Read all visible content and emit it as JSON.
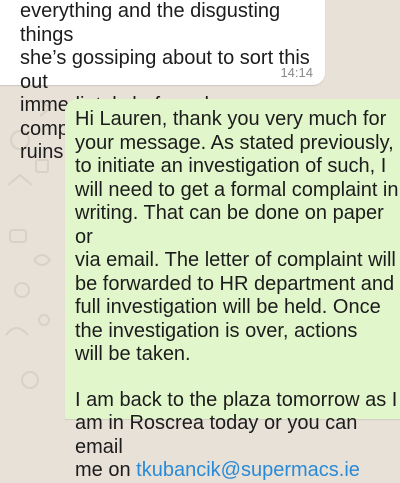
{
  "chat": {
    "incoming_message": {
      "text": "everything and the disgusting things\nshe’s gossiping about to sort this out\nimmediately before she completely\nruins my character.",
      "time": "14:14"
    },
    "outgoing_message": {
      "paragraph1": "Hi Lauren, thank you very much for\nyour message. As stated previously,\nto initiate an investigation of such, I\nwill need to get a formal complaint in\nwriting. That can be done on paper or\nvia email. The letter of complaint will\nbe forwarded to HR department and\nfull investigation will be held. Once\nthe investigation is over, actions\nwill be taken.",
      "paragraph2_text": "I am back to the plaza tomorrow as I\nam in Roscrea today or you can email\nme on ",
      "email": "tkubancik@supermacs.ie"
    },
    "colors": {
      "background": "#e8e1d8",
      "incoming_bubble": "#ffffff",
      "outgoing_bubble": "#e1f7cb",
      "link": "#2a8ad6"
    }
  }
}
